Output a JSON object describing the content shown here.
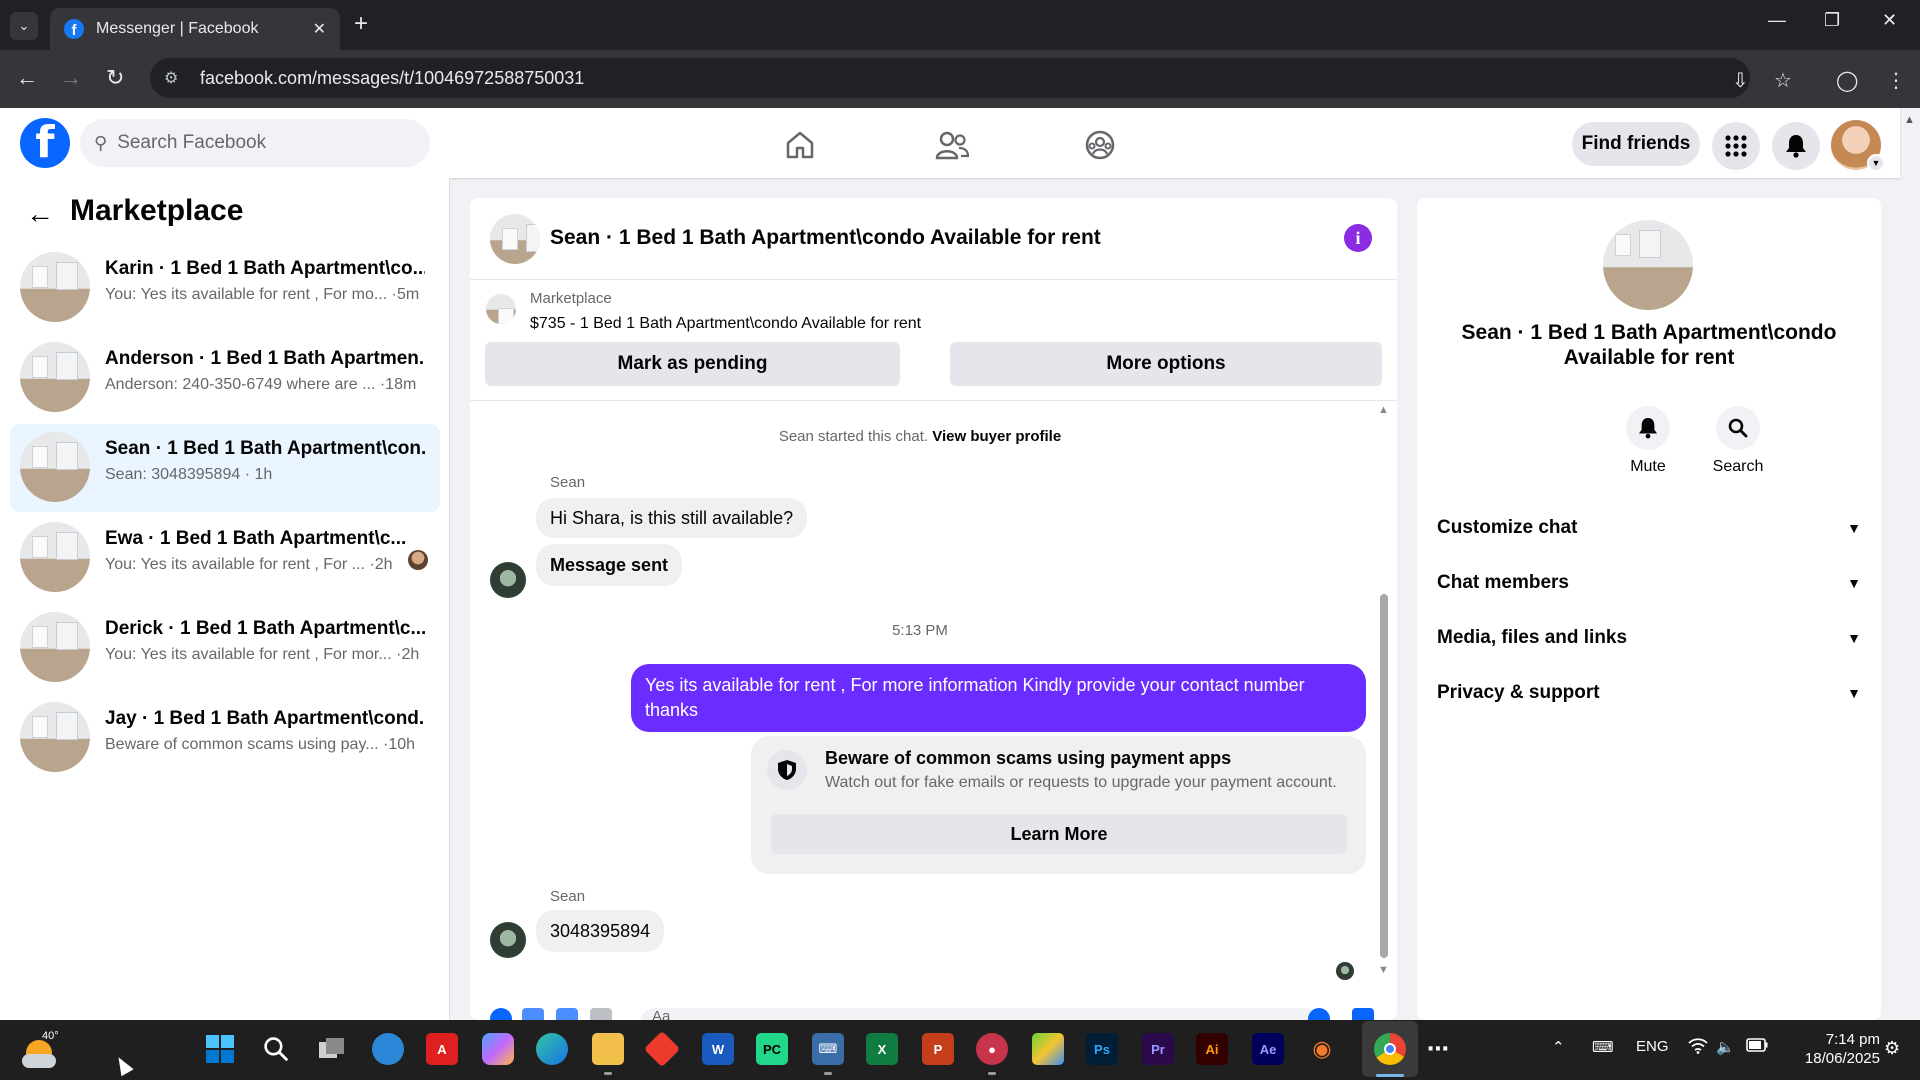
{
  "browser": {
    "tab_title": "Messenger | Facebook",
    "url": "facebook.com/messages/t/10046972588750031"
  },
  "facebook": {
    "search_placeholder": "Search Facebook",
    "find_friends": "Find friends"
  },
  "left": {
    "title": "Marketplace",
    "conversations": [
      {
        "name": "Karin · 1 Bed 1 Bath Apartment\\co...",
        "preview": "You: Yes its available for rent , For mo... ·5m",
        "active": false
      },
      {
        "name": "Anderson · 1 Bed 1 Bath Apartmen...",
        "preview": "Anderson: 240-350-6749 where are ... ·18m",
        "active": false
      },
      {
        "name": "Sean · 1 Bed 1 Bath Apartment\\con...",
        "preview": "Sean: 3048395894 · 1h",
        "active": true
      },
      {
        "name": "Ewa · 1 Bed 1 Bath Apartment\\c...",
        "preview": "You: Yes its available for rent , For ... ·2h",
        "active": false
      },
      {
        "name": "Derick · 1 Bed 1 Bath Apartment\\c...",
        "preview": "You: Yes its available for rent , For mor... ·2h",
        "active": false
      },
      {
        "name": "Jay · 1 Bed 1 Bath Apartment\\cond...",
        "preview": "Beware of common scams using pay... ·10h",
        "active": false
      }
    ]
  },
  "chat": {
    "title": "Sean · 1 Bed 1 Bath Apartment\\condo Available for rent",
    "marketplace_label": "Marketplace",
    "listing": "$735 - 1 Bed 1 Bath Apartment\\condo Available for rent",
    "mark_pending": "Mark as pending",
    "more_options": "More options",
    "started_text": "Sean started this chat.",
    "view_profile": "View buyer profile",
    "sender1": "Sean",
    "msg1": "Hi Shara, is this still available?",
    "msg2": "Message sent",
    "timestamp": "5:13 PM",
    "msg_out": "Yes its  available for rent , For more information Kindly provide your contact number thanks",
    "scam_title": "Beware of common scams using payment apps",
    "scam_body": "Watch out for fake emails or requests to upgrade your payment account.",
    "learn_more": "Learn More",
    "sender2": "Sean",
    "msg3": "3048395894",
    "composer_placeholder": "Aa"
  },
  "right": {
    "name": "Sean · 1 Bed 1 Bath Apartment\\condo Available for rent",
    "mute": "Mute",
    "search": "Search",
    "sections": [
      "Customize chat",
      "Chat members",
      "Media, files and links",
      "Privacy & support"
    ]
  },
  "taskbar": {
    "weather_temp": "40°",
    "lang": "ENG",
    "time": "7:14 pm",
    "date": "18/06/2025",
    "apps": [
      "start",
      "search",
      "task-view",
      "maps",
      "acrobat",
      "copilot",
      "edge",
      "file-explorer",
      "anydesk",
      "word",
      "pycharm",
      "keyboard",
      "excel",
      "powerpoint",
      "recorder",
      "bluestacks",
      "photoshop",
      "premiere",
      "illustrator",
      "after-effects",
      "blender",
      "chrome",
      "more"
    ],
    "colors": {
      "word": "#185abd",
      "excel": "#107c41",
      "powerpoint": "#c43e1c",
      "photoshop": "#001e36",
      "premiere": "#2a0a4a",
      "illustrator": "#330000",
      "after_effects": "#00005b"
    }
  },
  "colors": {
    "brand": "#0866ff",
    "outgoing_bubble": "#6b2cff",
    "info": "#8b2be2"
  }
}
